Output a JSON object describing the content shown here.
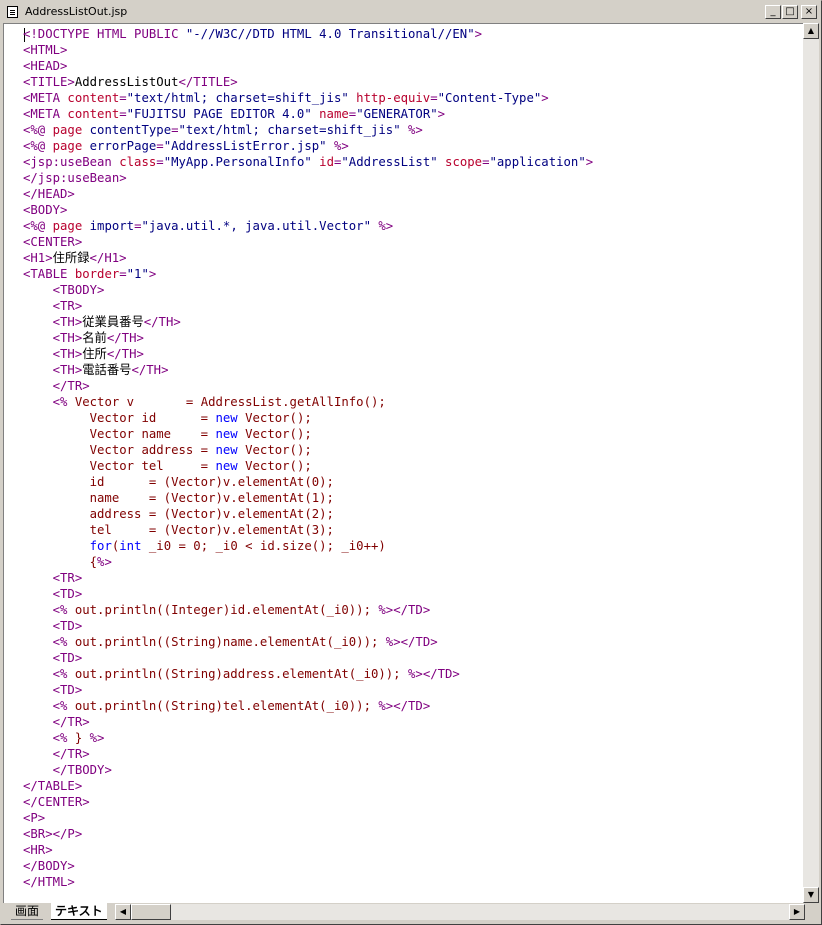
{
  "window": {
    "title": "AddressListOut.jsp",
    "minimize_glyph": "_",
    "maximize_glyph": "□",
    "close_glyph": "×"
  },
  "scrollbars": {
    "up_glyph": "▲",
    "down_glyph": "▼",
    "left_glyph": "◀",
    "right_glyph": "▶"
  },
  "tabs": [
    {
      "label": "画面",
      "active": false
    },
    {
      "label": "テキスト",
      "active": true
    }
  ],
  "code_lines": [
    [
      [
        "tag",
        "<!DOCTYPE HTML PUBLIC "
      ],
      [
        "val",
        "\"-//W3C//DTD HTML 4.0 Transitional//EN\""
      ],
      [
        "tag",
        ">"
      ]
    ],
    [
      [
        "tag",
        "<HTML>"
      ]
    ],
    [
      [
        "tag",
        "<HEAD>"
      ]
    ],
    [
      [
        "tag",
        "<TITLE>"
      ],
      [
        "txt",
        "AddressListOut"
      ],
      [
        "tag",
        "</TITLE>"
      ]
    ],
    [
      [
        "tag",
        "<META "
      ],
      [
        "attr",
        "content"
      ],
      [
        "tag",
        "="
      ],
      [
        "val",
        "\"text/html; charset=shift_jis\""
      ],
      [
        "tag",
        " "
      ],
      [
        "attr",
        "http-equiv"
      ],
      [
        "tag",
        "="
      ],
      [
        "val",
        "\"Content-Type\""
      ],
      [
        "tag",
        ">"
      ]
    ],
    [
      [
        "tag",
        "<META "
      ],
      [
        "attr",
        "content"
      ],
      [
        "tag",
        "="
      ],
      [
        "val",
        "\"FUJITSU PAGE EDITOR 4.0\""
      ],
      [
        "tag",
        " "
      ],
      [
        "attr",
        "name"
      ],
      [
        "tag",
        "="
      ],
      [
        "val",
        "\"GENERATOR\""
      ],
      [
        "tag",
        ">"
      ]
    ],
    [
      [
        "jsp",
        "<%@ "
      ],
      [
        "attr",
        "page"
      ],
      [
        "tag",
        " "
      ],
      [
        "val",
        "contentType"
      ],
      [
        "tag",
        "="
      ],
      [
        "val",
        "\"text/html; charset=shift_jis\""
      ],
      [
        "jsp",
        " %>"
      ]
    ],
    [
      [
        "jsp",
        "<%@ "
      ],
      [
        "attr",
        "page"
      ],
      [
        "tag",
        " "
      ],
      [
        "val",
        "errorPage"
      ],
      [
        "tag",
        "="
      ],
      [
        "val",
        "\"AddressListError.jsp\""
      ],
      [
        "jsp",
        " %>"
      ]
    ],
    [
      [
        "tag",
        "<jsp:useBean "
      ],
      [
        "attr",
        "class"
      ],
      [
        "tag",
        "="
      ],
      [
        "val",
        "\"MyApp.PersonalInfo\""
      ],
      [
        "tag",
        " "
      ],
      [
        "attr",
        "id"
      ],
      [
        "tag",
        "="
      ],
      [
        "val",
        "\"AddressList\""
      ],
      [
        "tag",
        " "
      ],
      [
        "attr",
        "scope"
      ],
      [
        "tag",
        "="
      ],
      [
        "val",
        "\"application\""
      ],
      [
        "tag",
        ">"
      ]
    ],
    [
      [
        "tag",
        "</jsp:useBean>"
      ]
    ],
    [
      [
        "tag",
        "</HEAD>"
      ]
    ],
    [
      [
        "tag",
        "<BODY>"
      ]
    ],
    [
      [
        "jsp",
        "<%@ "
      ],
      [
        "attr",
        "page"
      ],
      [
        "tag",
        " "
      ],
      [
        "val",
        "import"
      ],
      [
        "tag",
        "="
      ],
      [
        "val",
        "\"java.util.*, java.util.Vector\""
      ],
      [
        "jsp",
        " %>"
      ]
    ],
    [
      [
        "tag",
        "<CENTER>"
      ]
    ],
    [
      [
        "tag",
        "<H1>"
      ],
      [
        "txt",
        "住所録"
      ],
      [
        "tag",
        "</H1>"
      ]
    ],
    [
      [
        "tag",
        "<TABLE "
      ],
      [
        "attr",
        "border"
      ],
      [
        "tag",
        "="
      ],
      [
        "val",
        "\"1\""
      ],
      [
        "tag",
        ">"
      ]
    ],
    [
      [
        "txt",
        "    "
      ],
      [
        "tag",
        "<TBODY>"
      ]
    ],
    [
      [
        "txt",
        "    "
      ],
      [
        "tag",
        "<TR>"
      ]
    ],
    [
      [
        "txt",
        "    "
      ],
      [
        "tag",
        "<TH>"
      ],
      [
        "txt",
        "従業員番号"
      ],
      [
        "tag",
        "</TH>"
      ]
    ],
    [
      [
        "txt",
        "    "
      ],
      [
        "tag",
        "<TH>"
      ],
      [
        "txt",
        "名前"
      ],
      [
        "tag",
        "</TH>"
      ]
    ],
    [
      [
        "txt",
        "    "
      ],
      [
        "tag",
        "<TH>"
      ],
      [
        "txt",
        "住所"
      ],
      [
        "tag",
        "</TH>"
      ]
    ],
    [
      [
        "txt",
        "    "
      ],
      [
        "tag",
        "<TH>"
      ],
      [
        "txt",
        "電話番号"
      ],
      [
        "tag",
        "</TH>"
      ]
    ],
    [
      [
        "txt",
        "    "
      ],
      [
        "tag",
        "</TR>"
      ]
    ],
    [
      [
        "txt",
        "    "
      ],
      [
        "jsp",
        "<%"
      ],
      [
        "java",
        " Vector v       = AddressList.getAllInfo();"
      ]
    ],
    [
      [
        "java",
        "         Vector id      = "
      ],
      [
        "kw",
        "new"
      ],
      [
        "java",
        " Vector();"
      ]
    ],
    [
      [
        "java",
        "         Vector name    = "
      ],
      [
        "kw",
        "new"
      ],
      [
        "java",
        " Vector();"
      ]
    ],
    [
      [
        "java",
        "         Vector address = "
      ],
      [
        "kw",
        "new"
      ],
      [
        "java",
        " Vector();"
      ]
    ],
    [
      [
        "java",
        "         Vector tel     = "
      ],
      [
        "kw",
        "new"
      ],
      [
        "java",
        " Vector();"
      ]
    ],
    [
      [
        "java",
        "         id      = (Vector)v.elementAt(0);"
      ]
    ],
    [
      [
        "java",
        "         name    = (Vector)v.elementAt(1);"
      ]
    ],
    [
      [
        "java",
        "         address = (Vector)v.elementAt(2);"
      ]
    ],
    [
      [
        "java",
        "         tel     = (Vector)v.elementAt(3);"
      ]
    ],
    [
      [
        "java",
        "         "
      ],
      [
        "kw",
        "for"
      ],
      [
        "java",
        "("
      ],
      [
        "kw",
        "int"
      ],
      [
        "java",
        " _i0 = 0; _i0 < id.size(); _i0++)"
      ]
    ],
    [
      [
        "java",
        "         {"
      ],
      [
        "jsp",
        "%>"
      ]
    ],
    [
      [
        "txt",
        "    "
      ],
      [
        "tag",
        "<TR>"
      ]
    ],
    [
      [
        "txt",
        "    "
      ],
      [
        "tag",
        "<TD>"
      ]
    ],
    [
      [
        "txt",
        "    "
      ],
      [
        "jsp",
        "<%"
      ],
      [
        "java",
        " out.println((Integer)id.elementAt(_i0)); "
      ],
      [
        "jsp",
        "%>"
      ],
      [
        "tag",
        "</TD>"
      ]
    ],
    [
      [
        "txt",
        "    "
      ],
      [
        "tag",
        "<TD>"
      ]
    ],
    [
      [
        "txt",
        "    "
      ],
      [
        "jsp",
        "<%"
      ],
      [
        "java",
        " out.println((String)name.elementAt(_i0)); "
      ],
      [
        "jsp",
        "%>"
      ],
      [
        "tag",
        "</TD>"
      ]
    ],
    [
      [
        "txt",
        "    "
      ],
      [
        "tag",
        "<TD>"
      ]
    ],
    [
      [
        "txt",
        "    "
      ],
      [
        "jsp",
        "<%"
      ],
      [
        "java",
        " out.println((String)address.elementAt(_i0)); "
      ],
      [
        "jsp",
        "%>"
      ],
      [
        "tag",
        "</TD>"
      ]
    ],
    [
      [
        "txt",
        "    "
      ],
      [
        "tag",
        "<TD>"
      ]
    ],
    [
      [
        "txt",
        "    "
      ],
      [
        "jsp",
        "<%"
      ],
      [
        "java",
        " out.println((String)tel.elementAt(_i0)); "
      ],
      [
        "jsp",
        "%>"
      ],
      [
        "tag",
        "</TD>"
      ]
    ],
    [
      [
        "txt",
        "    "
      ],
      [
        "tag",
        "</TR>"
      ]
    ],
    [
      [
        "txt",
        "    "
      ],
      [
        "jsp",
        "<%"
      ],
      [
        "java",
        " } "
      ],
      [
        "jsp",
        "%>"
      ]
    ],
    [
      [
        "txt",
        "    "
      ],
      [
        "tag",
        "</TR>"
      ]
    ],
    [
      [
        "txt",
        "    "
      ],
      [
        "tag",
        "</TBODY>"
      ]
    ],
    [
      [
        "tag",
        "</TABLE>"
      ]
    ],
    [
      [
        "tag",
        "</CENTER>"
      ]
    ],
    [
      [
        "tag",
        "<P>"
      ]
    ],
    [
      [
        "tag",
        "<BR></P>"
      ]
    ],
    [
      [
        "tag",
        "<HR>"
      ]
    ],
    [
      [
        "tag",
        "</BODY>"
      ]
    ],
    [
      [
        "tag",
        "</HTML>"
      ]
    ]
  ]
}
